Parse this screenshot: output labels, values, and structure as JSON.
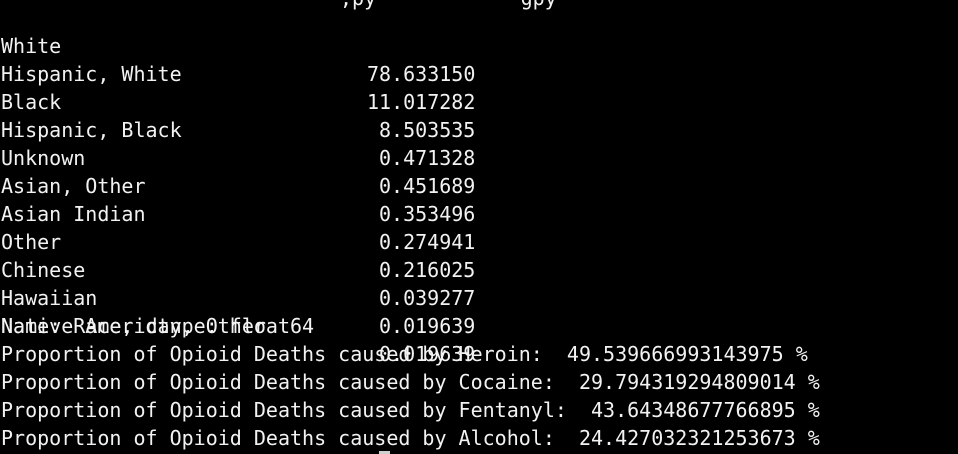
{
  "terminal": {
    "cut_off_top_line": ",py            gpy",
    "value_counts": [
      {
        "label": "White",
        "value": "78.633150"
      },
      {
        "label": "Hispanic, White",
        "value": "11.017282"
      },
      {
        "label": "Black",
        "value": "8.503535"
      },
      {
        "label": "Hispanic, Black",
        "value": "0.471328"
      },
      {
        "label": "Unknown",
        "value": "0.451689"
      },
      {
        "label": "Asian, Other",
        "value": "0.353496"
      },
      {
        "label": "Asian Indian",
        "value": "0.274941"
      },
      {
        "label": "Other",
        "value": "0.216025"
      },
      {
        "label": "Chinese",
        "value": "0.039277"
      },
      {
        "label": "Hawaiian",
        "value": "0.019639"
      },
      {
        "label": "Native American, Other",
        "value": "0.019639"
      }
    ],
    "series_footer": "Name: Race, dtype: float64",
    "proportions": [
      "Proportion of Opioid Deaths caused by Heroin:  49.539666993143975 %",
      "Proportion of Opioid Deaths caused by Cocaine:  29.794319294809014 %",
      "Proportion of Opioid Deaths caused by Fentanyl:  43.64348677766895 %",
      "Proportion of Opioid Deaths caused by Alcohol:  24.427032321253673 %"
    ]
  }
}
